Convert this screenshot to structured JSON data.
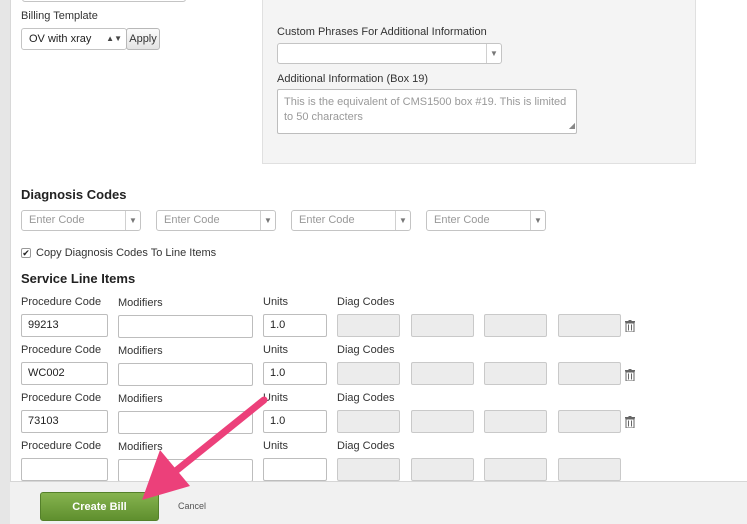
{
  "billing_template": {
    "label": "Billing Template",
    "selected": "OV with xray",
    "apply_label": "Apply"
  },
  "custom_phrases": {
    "label": "Custom Phrases For Additional Information"
  },
  "additional_info": {
    "label": "Additional Information (Box 19)",
    "placeholder": "This is the equivalent of CMS1500 box #19. This is limited to 50 characters"
  },
  "diagnosis": {
    "heading": "Diagnosis Codes",
    "placeholders": [
      "Enter Code",
      "Enter Code",
      "Enter Code",
      "Enter Code"
    ],
    "copy_label": "Copy Diagnosis Codes To Line Items",
    "copy_checked": true
  },
  "service_lines": {
    "heading": "Service Line Items",
    "labels": {
      "procedure": "Procedure Code",
      "modifiers": "Modifiers",
      "units": "Units",
      "diag": "Diag Codes"
    },
    "rows": [
      {
        "procedure": "99213",
        "modifiers": "",
        "units": "1.0"
      },
      {
        "procedure": "WC002",
        "modifiers": "",
        "units": "1.0"
      },
      {
        "procedure": "73103",
        "modifiers": "",
        "units": "1.0"
      },
      {
        "procedure": "",
        "modifiers": "",
        "units": ""
      }
    ]
  },
  "footer": {
    "create_label": "Create Bill",
    "cancel_label": "Cancel"
  },
  "colors": {
    "create_button": "#6b9a37",
    "arrow": "#ec407a"
  }
}
